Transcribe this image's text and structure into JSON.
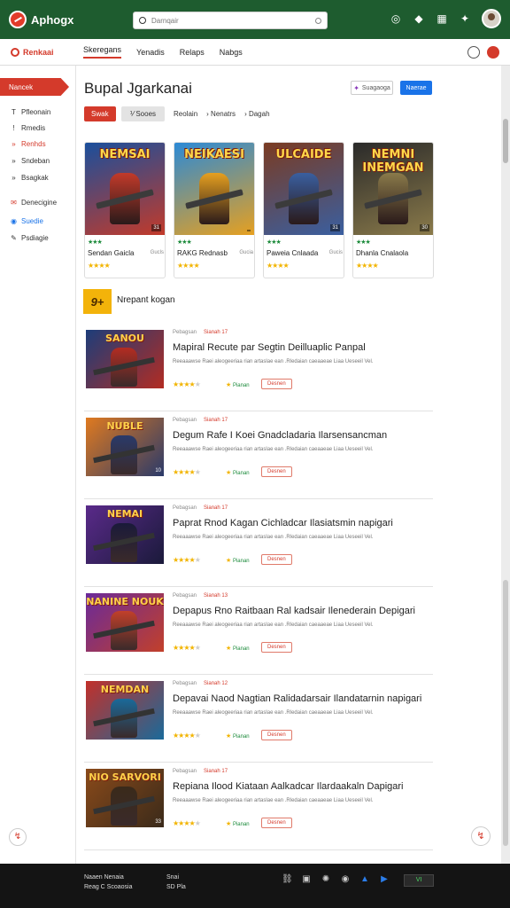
{
  "topbar": {
    "app_name": "Aphogx",
    "search_placeholder": "Darnqair",
    "icons": [
      "whatsapp-icon",
      "compass-icon",
      "grid-icon",
      "star-icon"
    ]
  },
  "nav": {
    "brand": "Renkaai",
    "links": [
      "Skeregans",
      "Yenadis",
      "Relaps",
      "Nabgs"
    ]
  },
  "sidebar": {
    "active": "Nancek",
    "items": [
      {
        "label": "Pfleonain",
        "icon": "T"
      },
      {
        "label": "Rmedis",
        "icon": "!"
      },
      {
        "label": "Renhds",
        "icon": "»"
      },
      {
        "label": "Sndeban",
        "icon": "»"
      },
      {
        "label": "Bsagkak",
        "icon": "»"
      },
      {
        "label": "Denecigine",
        "icon": "✉"
      },
      {
        "label": "Suedie",
        "icon": "◉"
      },
      {
        "label": "Psdiagie",
        "icon": "✎"
      }
    ]
  },
  "main": {
    "title": "Bupal Jgarkanai",
    "btn_outline": "Suagaoga",
    "btn_blue": "Naerae",
    "filters": {
      "red": "Swak",
      "grey": "Sooes",
      "text1": "Reolain",
      "text2": "Nenatrs",
      "text3": "Dagah"
    },
    "cards": [
      {
        "art_title": "NEMSAI",
        "name": "Sendan Gaicla",
        "small": "Gucls",
        "badge": "31",
        "colors": [
          "#1a4f9c",
          "#c23a2a"
        ]
      },
      {
        "art_title": "NEIKAESI",
        "name": "RAKG Rednasb",
        "small": "Gucia",
        "badge": "",
        "colors": [
          "#2c8ad6",
          "#e6a020"
        ]
      },
      {
        "art_title": "ULCAIDE",
        "name": "Paweia Cnlaada",
        "small": "Gucis",
        "badge": "31",
        "colors": [
          "#7a3b22",
          "#3a5fa0"
        ]
      },
      {
        "art_title": "NEMNI INEMGAN",
        "name": "Dhanla Cnalaola",
        "small": "",
        "badge": "30",
        "colors": [
          "#2a2a2a",
          "#8a7a4a"
        ]
      }
    ],
    "section": {
      "badge": "9+",
      "title": "Nrepant kogan"
    },
    "articles": [
      {
        "thumb_title": "SANOU",
        "meta_a": "Pebagsan",
        "meta_b": "Sianah 17",
        "headline": "Mapiral Recute par Segtin Deilluaplic Panpal",
        "desc": "Reeaaawse Raei aleogeeriaa rian artaslae ean .Rledaian caeaaeae Liaa Ueseeil Vel.",
        "stars": 4,
        "tag": "Pianan",
        "pill": "Desnen",
        "colors": [
          "#1c3d7a",
          "#b32c22"
        ],
        "badge": ""
      },
      {
        "thumb_title": "NUBLE",
        "meta_a": "Pebagsan",
        "meta_b": "Sianah 17",
        "headline": "Degum Rafe I Koei Gnadcladaria Ilarsensancman",
        "desc": "Reeaaawse Raei aleogeeriaa rian artaslae ean .Rledaian caeaaeae Liaa Ueseeil Vel.",
        "stars": 4,
        "tag": "Pianan",
        "pill": "Desnen",
        "colors": [
          "#e07a1f",
          "#2a3a6a"
        ],
        "badge": "10"
      },
      {
        "thumb_title": "NEMAI",
        "meta_a": "Pebagsan",
        "meta_b": "Sianah 17",
        "headline": "Paprat Rnod Kagan Cichladcar Ilasiatsmin napigari",
        "desc": "Reeaaawse Raei aleogeeriaa rian artaslae ean .Rledaian caeaaeae Liaa Ueseeil Vel.",
        "stars": 4,
        "tag": "Pianan",
        "pill": "Desnen",
        "colors": [
          "#5a2a8a",
          "#1a1a3a"
        ],
        "badge": ""
      },
      {
        "thumb_title": "NANINE NOUK",
        "meta_a": "Pebagsan",
        "meta_b": "Sianah 13",
        "headline": "Depapus Rno Raitbaan Ral kadsair Ilenederain Depigari",
        "desc": "Reeaaawse Raei aleogeeriaa rian artaslae ean .Rledaian caeaaeae Liaa Ueseeil Vel.",
        "stars": 4,
        "tag": "Pianan",
        "pill": "Desnen",
        "colors": [
          "#6a2a9a",
          "#c2402a"
        ],
        "badge": ""
      },
      {
        "thumb_title": "NEMDAN",
        "meta_a": "Pebagsan",
        "meta_b": "Sianah 12",
        "headline": "Depavai Naod Nagtian Ralidadarsair Ilandatarnin napigari",
        "desc": "Reeaaawse Raei aleogeeriaa rian artaslae ean .Rledaian caeaaeae Liaa Ueseeil Vel.",
        "stars": 4,
        "tag": "Pianan",
        "pill": "Desnen",
        "colors": [
          "#c2302a",
          "#1a6a9a"
        ],
        "badge": ""
      },
      {
        "thumb_title": "NIO SARVORI",
        "meta_a": "Pebagsan",
        "meta_b": "Sianah 17",
        "headline": "Repiana Ilood Kiataan Aalkadcar Ilardaakaln Dapigari",
        "desc": "Reeaaawse Raei aleogeeriaa rian artaslae ean .Rledaian caeaaeae Liaa Ueseeil Vel.",
        "stars": 4,
        "tag": "Pianan",
        "pill": "Desnen",
        "colors": [
          "#8a4a1a",
          "#3a2a1a"
        ],
        "badge": "33"
      }
    ]
  },
  "taskbar": {
    "left_l1": "Naaen Nenaia",
    "left_l2": "Reag C Scoaosia",
    "mid_l1": "Snai",
    "mid_l2": "SD Pla",
    "badge": "VI"
  }
}
